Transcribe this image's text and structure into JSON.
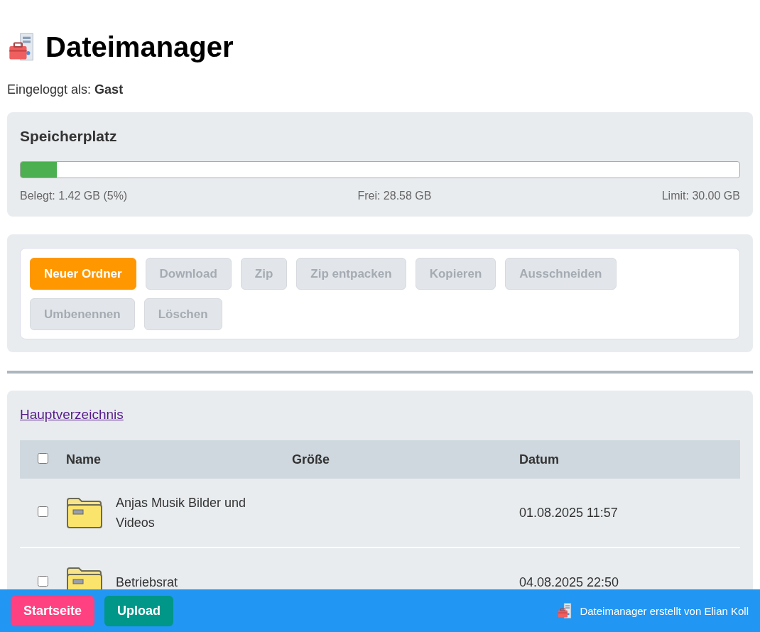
{
  "header": {
    "title": "Dateimanager",
    "login_label": "Eingeloggt als:",
    "user": "Gast"
  },
  "storage": {
    "title": "Speicherplatz",
    "level": 0.05,
    "used": "Belegt: 1.42 GB (5%)",
    "free": "Frei: 28.58 GB",
    "limit": "Limit: 30.00 GB"
  },
  "toolbar": {
    "buttons": [
      {
        "label": "Neuer Ordner",
        "disabled": false
      },
      {
        "label": "Download",
        "disabled": true
      },
      {
        "label": "Zip",
        "disabled": true
      },
      {
        "label": "Zip entpacken",
        "disabled": true
      },
      {
        "label": "Kopieren",
        "disabled": true
      },
      {
        "label": "Ausschneiden",
        "disabled": true
      },
      {
        "label": "Umbenennen",
        "disabled": true
      },
      {
        "label": "Löschen",
        "disabled": true
      }
    ]
  },
  "files": {
    "breadcrumb": "Hauptverzeichnis",
    "select_all": {
      "checked": false
    },
    "columns": [
      "Name",
      "Größe",
      "Datum"
    ],
    "rows": [
      {
        "kind": "folder",
        "checked": false,
        "name": "Anjas Musik Bilder und Videos",
        "date": "01.08.2025 11:57"
      },
      {
        "kind": "folder",
        "checked": false,
        "name": "Betriebsrat",
        "date": "04.08.2025 22:50"
      }
    ]
  },
  "footer": {
    "buttons": [
      {
        "label": "Startseite",
        "color": "#ff4081"
      },
      {
        "label": "Upload",
        "color": "#009688"
      }
    ],
    "credit": "Dateimanager erstellt von Elian Koll"
  }
}
